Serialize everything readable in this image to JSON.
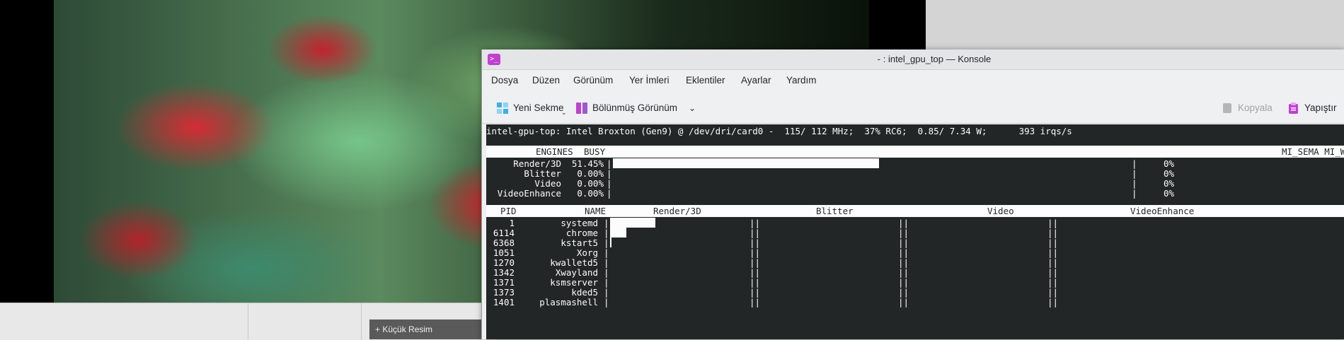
{
  "konsole": {
    "title": "- : intel_gpu_top — Konsole",
    "menu": [
      "Dosya",
      "Düzen",
      "Görünüm",
      "Yer İmleri",
      "Eklentiler",
      "Ayarlar",
      "Yardım"
    ],
    "toolbar": {
      "new_tab": "Yeni Sekme",
      "split_view": "Bölünmüş Görünüm",
      "copy": "Kopyala",
      "paste": "Yapıştır"
    }
  },
  "filemgr": {
    "thumbnail_button": "+ Küçük Resim"
  },
  "terminal": {
    "status_line": "intel-gpu-top: Intel Broxton (Gen9) @ /dev/dri/card0 -  115/ 112 MHz;  37% RC6;  0.85/ 7.34 W;      393 irqs/s",
    "engines_header": {
      "engines": "ENGINES",
      "busy": "BUSY",
      "right": "MI_SEMA MI_W"
    },
    "engines": [
      {
        "name": "Render/3D",
        "busy": "51.45%",
        "sema": "0%",
        "fill": 0.5145
      },
      {
        "name": "Blitter",
        "busy": "0.00%",
        "sema": "0%",
        "fill": 0
      },
      {
        "name": "Video",
        "busy": "0.00%",
        "sema": "0%",
        "fill": 0
      },
      {
        "name": "VideoEnhance",
        "busy": "0.00%",
        "sema": "0%",
        "fill": 0
      }
    ],
    "proc_header": {
      "pid": "PID",
      "name": "NAME",
      "cols": [
        "Render/3D",
        "Blitter",
        "Video",
        "VideoEnhance"
      ]
    },
    "processes": [
      {
        "pid": "1",
        "name": "systemd",
        "render": 0.33
      },
      {
        "pid": "6114",
        "name": "chrome",
        "render": 0.12
      },
      {
        "pid": "6368",
        "name": "kstart5",
        "render": 0.01
      },
      {
        "pid": "1051",
        "name": "Xorg",
        "render": 0
      },
      {
        "pid": "1270",
        "name": "kwalletd5",
        "render": 0
      },
      {
        "pid": "1342",
        "name": "Xwayland",
        "render": 0
      },
      {
        "pid": "1371",
        "name": "ksmserver",
        "render": 0
      },
      {
        "pid": "1373",
        "name": "kded5",
        "render": 0
      },
      {
        "pid": "1401",
        "name": "plasmashell",
        "render": 0
      }
    ]
  }
}
